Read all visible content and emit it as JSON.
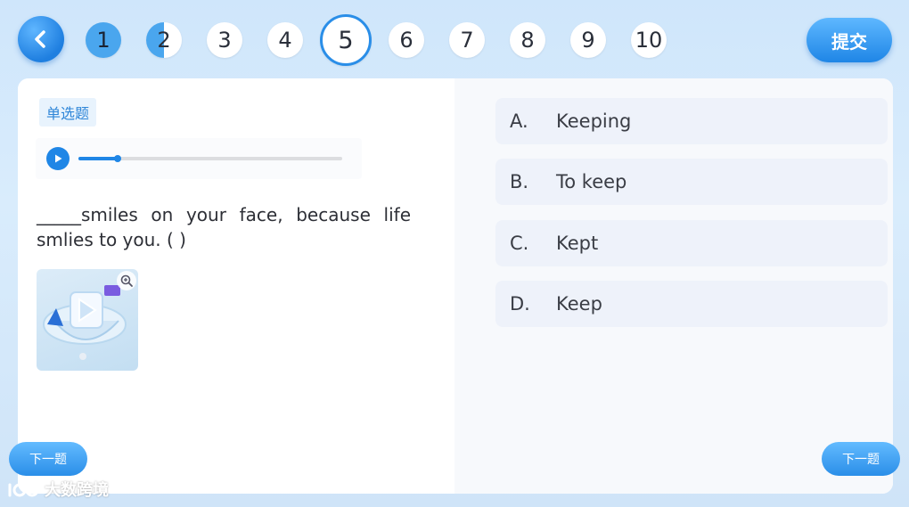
{
  "nav": {
    "questions": [
      {
        "label": "1",
        "state": "answered"
      },
      {
        "label": "2",
        "state": "half"
      },
      {
        "label": "3",
        "state": "unanswered"
      },
      {
        "label": "4",
        "state": "unanswered"
      },
      {
        "label": "5",
        "state": "current"
      },
      {
        "label": "6",
        "state": "unanswered"
      },
      {
        "label": "7",
        "state": "unanswered"
      },
      {
        "label": "8",
        "state": "unanswered"
      },
      {
        "label": "9",
        "state": "unanswered"
      },
      {
        "label": "10",
        "state": "unanswered"
      }
    ],
    "submit_label": "提交"
  },
  "question": {
    "type_label": "单选题",
    "audio_progress": 0.15,
    "text": "_____smiles on your face, because life smlies to you. ( )",
    "options": [
      {
        "letter": "A.",
        "text": "Keeping"
      },
      {
        "letter": "B.",
        "text": "To keep"
      },
      {
        "letter": "C.",
        "text": "Kept"
      },
      {
        "letter": "D.",
        "text": "Keep"
      }
    ]
  },
  "footer": {
    "next_left_label": "下一题",
    "next_right_label": "下一题"
  },
  "watermark": {
    "text": "大数跨境"
  },
  "colors": {
    "accent": "#1f86e6",
    "option_bg": "#eef2fa",
    "page_bg": "#d9ecfc"
  }
}
